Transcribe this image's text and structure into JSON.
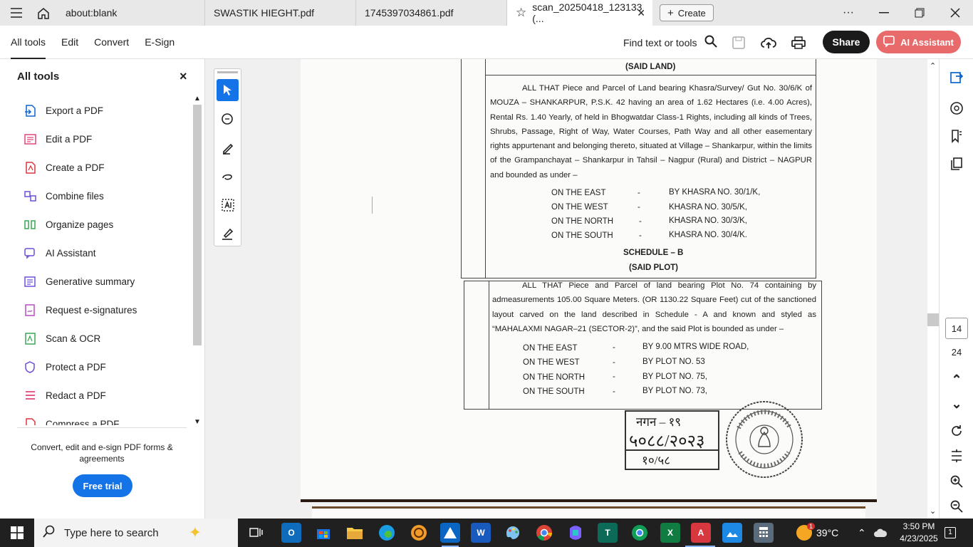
{
  "tabs": [
    {
      "label": "about:blank"
    },
    {
      "label": "SWASTIK HIEGHT.pdf"
    },
    {
      "label": "1745397034861.pdf"
    },
    {
      "label": "scan_20250418_123133 (..."
    }
  ],
  "tab_close": "✕",
  "create_label": "Create",
  "toolbar": {
    "menu": [
      "All tools",
      "Edit",
      "Convert",
      "E-Sign"
    ],
    "find_label": "Find text or tools",
    "share_label": "Share",
    "ai_label": "AI Assistant"
  },
  "left_panel": {
    "title": "All tools",
    "items": [
      {
        "label": "Export a PDF",
        "icon": "export-pdf-icon"
      },
      {
        "label": "Edit a PDF",
        "icon": "edit-pdf-icon"
      },
      {
        "label": "Create a PDF",
        "icon": "create-pdf-icon"
      },
      {
        "label": "Combine files",
        "icon": "combine-files-icon"
      },
      {
        "label": "Organize pages",
        "icon": "organize-pages-icon"
      },
      {
        "label": "AI Assistant",
        "icon": "ai-assistant-icon"
      },
      {
        "label": "Generative summary",
        "icon": "generative-summary-icon"
      },
      {
        "label": "Request e-signatures",
        "icon": "request-esign-icon"
      },
      {
        "label": "Scan & OCR",
        "icon": "scan-ocr-icon"
      },
      {
        "label": "Protect a PDF",
        "icon": "protect-pdf-icon"
      },
      {
        "label": "Redact a PDF",
        "icon": "redact-pdf-icon"
      },
      {
        "label": "Compress a PDF",
        "icon": "compress-pdf-icon"
      }
    ],
    "promo_text": "Convert, edit and e-sign PDF forms & agreements",
    "trial_label": "Free trial"
  },
  "document": {
    "heading_said_land": "(SAID LAND)",
    "para1": "ALL THAT Piece and Parcel of Land bearing Khasra/Survey/ Gut No. 30/6/K of MOUZA – SHANKARPUR, P.S.K. 42 having an area of 1.62 Hectares (i.e. 4.00 Acres), Rental Rs. 1.40 Yearly, of held in Bhogwatdar Class-1 Rights, including all kinds of Trees, Shrubs, Passage, Right of Way, Water Courses, Path Way and all other easementary rights appurtenant and belonging thereto, situated at Village – Shankarpur, within the limits of the Grampanchayat – Shankarpur in Tahsil – Nagpur (Rural) and District – NAGPUR and bounded as under –",
    "bounds1": [
      {
        "side": "ON THE EAST",
        "dash": "-",
        "value": "BY KHASRA NO. 30/1/K,"
      },
      {
        "side": "ON THE WEST",
        "dash": "-",
        "value": "KHASRA NO. 30/5/K,"
      },
      {
        "side": "ON THE NORTH",
        "dash": "-",
        "value": "KHASRA NO. 30/3/K,"
      },
      {
        "side": "ON THE SOUTH",
        "dash": "-",
        "value": "KHASRA NO. 30/4/K."
      }
    ],
    "schedule_b": "SCHEDULE – B",
    "heading_said_plot": "(SAID PLOT)",
    "para2": "ALL THAT Piece and Parcel of land bearing Plot No. 74 containing by admeasurements 105.00 Square Meters. (OR 1130.22 Square Feet) cut of the sanctioned layout carved on the land described in Schedule - A and known and styled as “MAHALAXMI NAGAR–21 (SECTOR-2)”, and the said Plot is bounded as under –",
    "bounds2": [
      {
        "side": "ON THE EAST",
        "dash": "-",
        "value": "BY 9.00 MTRS WIDE ROAD,"
      },
      {
        "side": "ON THE WEST",
        "dash": "-",
        "value": "BY PLOT NO. 53"
      },
      {
        "side": "ON THE NORTH",
        "dash": "-",
        "value": "BY PLOT NO. 75,"
      },
      {
        "side": "ON THE SOUTH",
        "dash": "-",
        "value": "BY PLOT NO. 73,"
      }
    ],
    "stamp_line1": "नगन – १९",
    "stamp_line2": "५०८८/२०२३",
    "stamp_line3": "१०/५८"
  },
  "page_nav": {
    "current": "14",
    "total": "24"
  },
  "taskbar": {
    "search_placeholder": "Type here to search",
    "weather": "39°C",
    "weather_badge": "1",
    "time": "3:50 PM",
    "date": "4/23/2025",
    "notifications": "1"
  },
  "colors": {
    "accent_blue": "#1473e6",
    "ai_red": "#e86a6a",
    "share_black": "#1a1a1a",
    "acrobat_red": "#d7373f"
  }
}
